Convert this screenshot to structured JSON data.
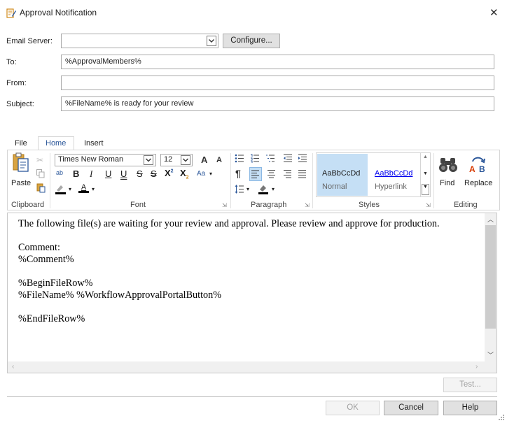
{
  "window": {
    "title": "Approval Notification",
    "close_glyph": "✕",
    "icon": "notification-edit-icon"
  },
  "form": {
    "email_server_label": "Email Server:",
    "email_server_value": "",
    "configure_label": "Configure...",
    "to_label": "To:",
    "to_value": "%ApprovalMembers%",
    "from_label": "From:",
    "from_value": "",
    "subject_label": "Subject:",
    "subject_value": "%FileName% is ready for your review"
  },
  "ribbon": {
    "tabs": [
      "File",
      "Home",
      "Insert"
    ],
    "active_tab": "Home",
    "clipboard": {
      "paste_label": "Paste",
      "group_label": "Clipboard"
    },
    "font": {
      "family": "Times New Roman",
      "size": "12",
      "group_label": "Font",
      "bold": "B",
      "italic": "I",
      "underline": "U",
      "double_underline": "U",
      "strike": "S",
      "double_strike": "S",
      "superscript": "X",
      "subscript": "X",
      "change_case": "Aa",
      "grow": "A",
      "shrink": "A",
      "font_color": "A",
      "highlight": "ab"
    },
    "paragraph": {
      "group_label": "Paragraph",
      "pilcrow": "¶"
    },
    "styles": {
      "group_label": "Styles",
      "normal_preview": "AaBbCcDd",
      "normal_name": "Normal",
      "hyperlink_preview": "AaBbCcDd",
      "hyperlink_name": "Hyperlink"
    },
    "editing": {
      "group_label": "Editing",
      "find_label": "Find",
      "replace_label": "Replace"
    }
  },
  "editor": {
    "lines": [
      "The following file(s) are waiting for your review and approval. Please review and approve for production.",
      "",
      "Comment:",
      "%Comment%",
      "",
      "%BeginFileRow%",
      "%FileName% %WorkflowApprovalPortalButton%",
      "",
      "%EndFileRow%"
    ]
  },
  "buttons": {
    "test": "Test...",
    "ok": "OK",
    "cancel": "Cancel",
    "help": "Help"
  },
  "colors": {
    "accent": "#2b579a",
    "selected_style_bg": "#c5dff5",
    "ribbon_border": "#d5d5d5"
  }
}
